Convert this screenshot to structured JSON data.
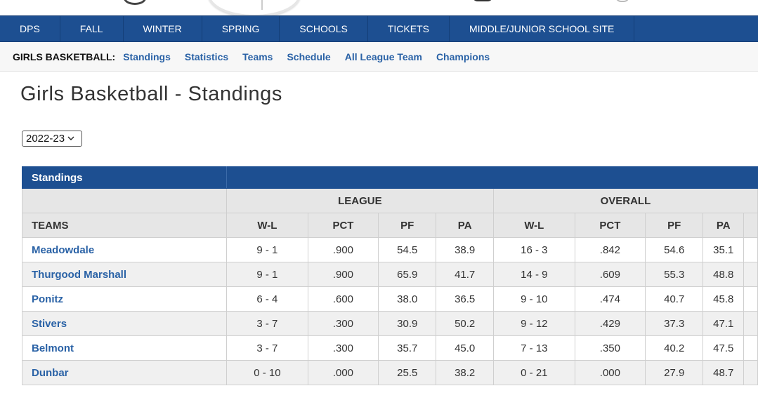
{
  "nav": {
    "items": [
      "DPS",
      "FALL",
      "WINTER",
      "SPRING",
      "SCHOOLS",
      "TICKETS",
      "MIDDLE/JUNIOR SCHOOL SITE"
    ]
  },
  "subnav": {
    "label": "GIRLS BASKETBALL:",
    "links": [
      "Standings",
      "Statistics",
      "Teams",
      "Schedule",
      "All League Team",
      "Champions"
    ]
  },
  "page": {
    "title": "Girls Basketball - Standings"
  },
  "season": {
    "selected": "2022-23"
  },
  "table": {
    "caption": "Standings",
    "groups": {
      "league": "LEAGUE",
      "overall": "OVERALL"
    },
    "columns": {
      "teams": "TEAMS",
      "league": [
        "W-L",
        "PCT",
        "PF",
        "PA"
      ],
      "overall": [
        "W-L",
        "PCT",
        "PF",
        "PA"
      ]
    },
    "rows": [
      {
        "team": "Meadowdale",
        "league": [
          "9 - 1",
          ".900",
          "54.5",
          "38.9"
        ],
        "overall": [
          "16 - 3",
          ".842",
          "54.6",
          "35.1"
        ]
      },
      {
        "team": "Thurgood Marshall",
        "league": [
          "9 - 1",
          ".900",
          "65.9",
          "41.7"
        ],
        "overall": [
          "14 - 9",
          ".609",
          "55.3",
          "48.8"
        ]
      },
      {
        "team": "Ponitz",
        "league": [
          "6 - 4",
          ".600",
          "38.0",
          "36.5"
        ],
        "overall": [
          "9 - 10",
          ".474",
          "40.7",
          "45.8"
        ]
      },
      {
        "team": "Stivers",
        "league": [
          "3 - 7",
          ".300",
          "30.9",
          "50.2"
        ],
        "overall": [
          "9 - 12",
          ".429",
          "37.3",
          "47.1"
        ]
      },
      {
        "team": "Belmont",
        "league": [
          "3 - 7",
          ".300",
          "35.7",
          "45.0"
        ],
        "overall": [
          "7 - 13",
          ".350",
          "40.2",
          "47.5"
        ]
      },
      {
        "team": "Dunbar",
        "league": [
          "0 - 10",
          ".000",
          "25.5",
          "38.2"
        ],
        "overall": [
          "0 - 21",
          ".000",
          "27.9",
          "48.7"
        ]
      }
    ]
  },
  "colors": {
    "nav_bg": "#1d4f91",
    "link": "#2a62a6",
    "row_alt": "#f0f0f0",
    "header_gray": "#e6e6e6"
  }
}
